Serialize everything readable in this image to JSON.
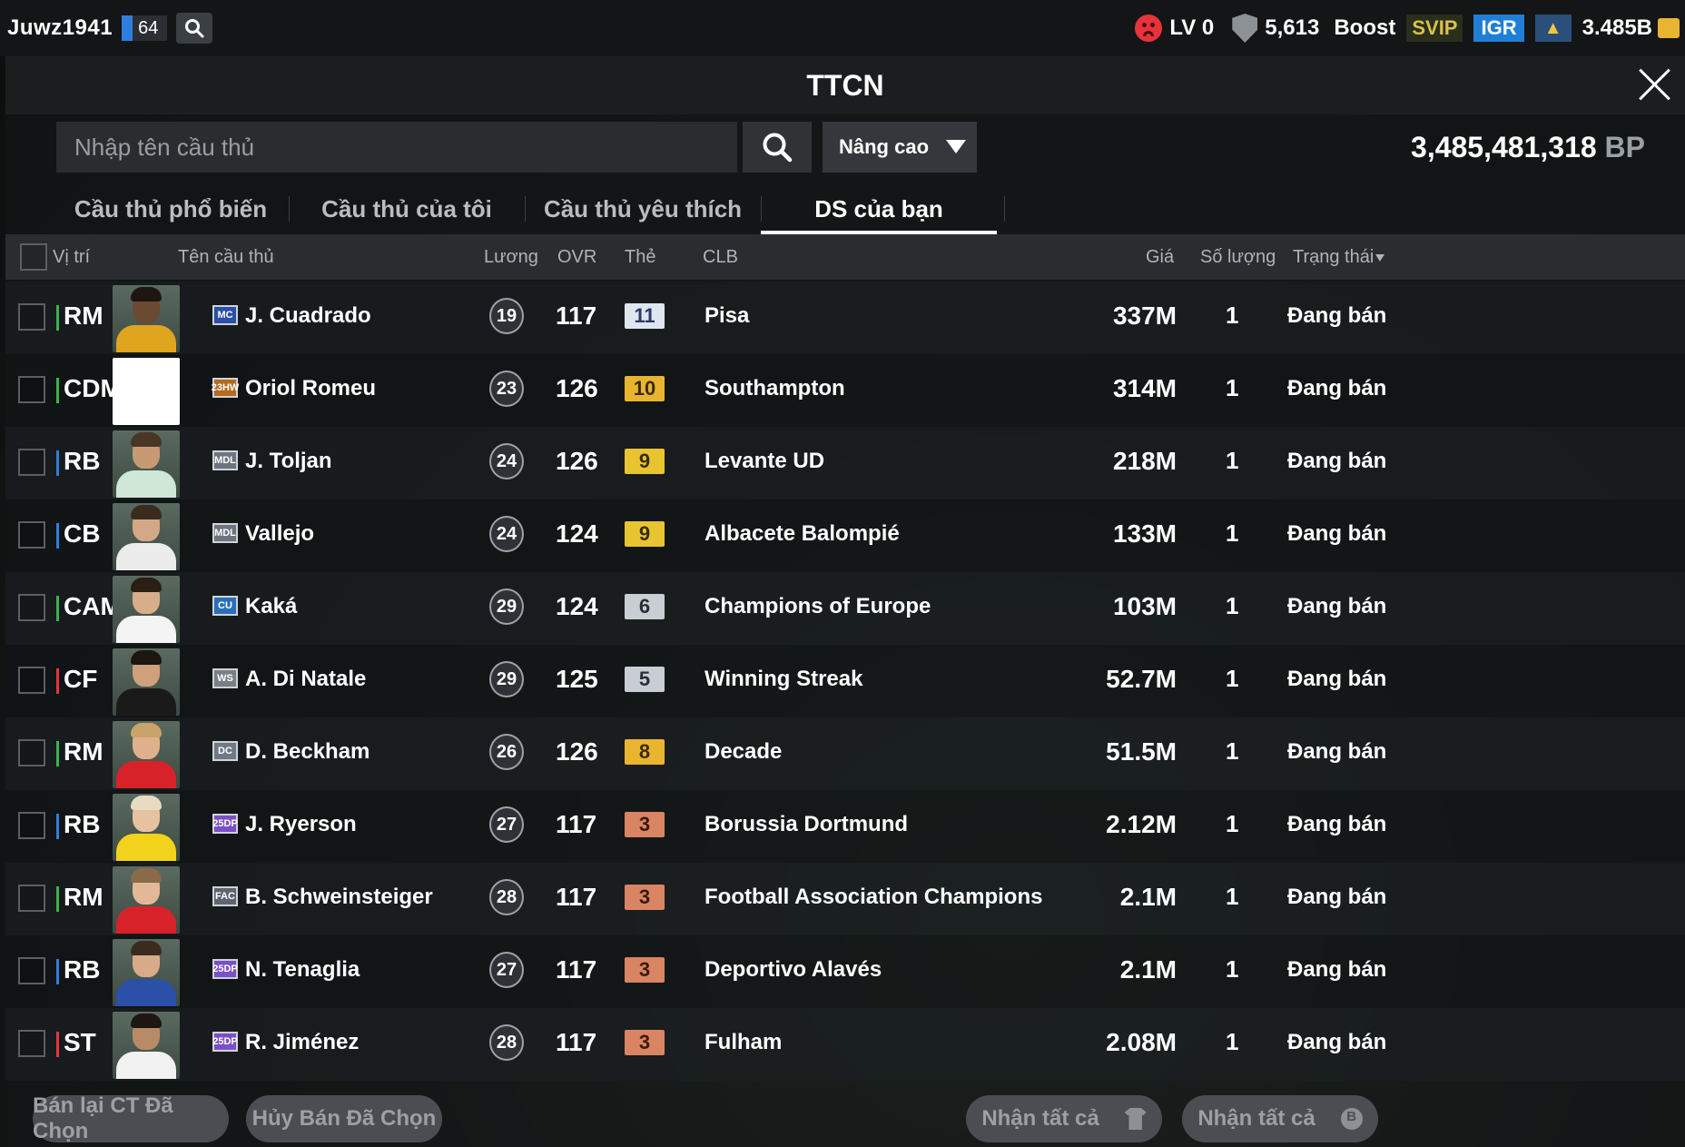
{
  "topbar": {
    "username": "Juwz1941",
    "level": "64",
    "lv": "LV 0",
    "shield_value": "5,613",
    "boost": "Boost",
    "svip": "SVIP",
    "igr": "IGR",
    "coins": "3.485B",
    "icons": [
      "search-icon",
      "sad-face-icon",
      "shield-icon",
      "arrow-up-icon",
      "coin-icon"
    ]
  },
  "panel": {
    "title": "TTCN",
    "search_placeholder": "Nhập tên cầu thủ",
    "advanced_label": "Nâng cao",
    "bp_value": "3,485,481,318",
    "bp_unit": "BP"
  },
  "tabs": [
    {
      "label": "Cầu thủ phổ biến",
      "active": false
    },
    {
      "label": "Cầu thủ của tôi",
      "active": false
    },
    {
      "label": "Cầu thủ yêu thích",
      "active": false
    },
    {
      "label": "DS của bạn",
      "active": true
    }
  ],
  "table": {
    "headers": {
      "position": "Vị trí",
      "name": "Tên cầu thủ",
      "wage": "Lương",
      "ovr": "OVR",
      "grade": "Thẻ",
      "club": "CLB",
      "price": "Giá",
      "qty": "Số lượng",
      "status": "Trạng thái"
    },
    "rows": [
      {
        "pos": "RM",
        "pos_color": "#39b54a",
        "season": "MC",
        "season_color": "#2a4fa8",
        "name": "J. Cuadrado",
        "wage": "19",
        "ovr": "117",
        "grade": "11",
        "grade_bg": "#dfe6f0",
        "grade_fg": "#2a3a6a",
        "club": "Pisa",
        "price": "337M",
        "qty": "1",
        "status": "Đang bán",
        "face": {
          "skin": "#6b4a33",
          "hair": "#1e1612",
          "shirt": "#e0a51f"
        }
      },
      {
        "pos": "CDM",
        "pos_color": "#39b54a",
        "season": "23HW",
        "season_color": "#b46a1e",
        "name": "Oriol Romeu",
        "wage": "23",
        "ovr": "126",
        "grade": "10",
        "grade_bg": "#e9b530",
        "grade_fg": "#3a2a05",
        "club": "Southampton",
        "price": "314M",
        "qty": "1",
        "status": "Đang bán",
        "face": {
          "skin": "#ffffff",
          "hair": "#ffffff",
          "shirt": "#ffffff"
        }
      },
      {
        "pos": "RB",
        "pos_color": "#2f7de1",
        "season": "MDL",
        "season_color": "#6b7480",
        "name": "J. Toljan",
        "wage": "24",
        "ovr": "126",
        "grade": "9",
        "grade_bg": "#e9c431",
        "grade_fg": "#3a2a05",
        "club": "Levante UD",
        "price": "218M",
        "qty": "1",
        "status": "Đang bán",
        "face": {
          "skin": "#c89a74",
          "hair": "#4a3626",
          "shirt": "#cfe7d6"
        }
      },
      {
        "pos": "CB",
        "pos_color": "#2f7de1",
        "season": "MDL",
        "season_color": "#6b7480",
        "name": "Vallejo",
        "wage": "24",
        "ovr": "124",
        "grade": "9",
        "grade_bg": "#e9c431",
        "grade_fg": "#3a2a05",
        "club": "Albacete Balompié",
        "price": "133M",
        "qty": "1",
        "status": "Đang bán",
        "face": {
          "skin": "#d4a886",
          "hair": "#3b2a1e",
          "shirt": "#ececec"
        }
      },
      {
        "pos": "CAM",
        "pos_color": "#39b54a",
        "season": "CU",
        "season_color": "#2a6fb8",
        "name": "Kaká",
        "wage": "29",
        "ovr": "124",
        "grade": "6",
        "grade_bg": "#c9ced4",
        "grade_fg": "#2a2e33",
        "club": "Champions of Europe",
        "price": "103M",
        "qty": "1",
        "status": "Đang bán",
        "face": {
          "skin": "#d8ad8a",
          "hair": "#2b1e14",
          "shirt": "#f4f4f4"
        }
      },
      {
        "pos": "CF",
        "pos_color": "#e8333a",
        "season": "WS",
        "season_color": "#7a7f86",
        "name": "A. Di Natale",
        "wage": "29",
        "ovr": "125",
        "grade": "5",
        "grade_bg": "#c9ced4",
        "grade_fg": "#2a2e33",
        "club": "Winning Streak",
        "price": "52.7M",
        "qty": "1",
        "status": "Đang bán",
        "face": {
          "skin": "#cfa07c",
          "hair": "#1c1612",
          "shirt": "#1a1a1a"
        }
      },
      {
        "pos": "RM",
        "pos_color": "#39b54a",
        "season": "DC",
        "season_color": "#6f7a86",
        "name": "D. Beckham",
        "wage": "26",
        "ovr": "126",
        "grade": "8",
        "grade_bg": "#e9b530",
        "grade_fg": "#3a2a05",
        "club": "Decade",
        "price": "51.5M",
        "qty": "1",
        "status": "Đang bán",
        "face": {
          "skin": "#e0b08c",
          "hair": "#c9a36a",
          "shirt": "#d8222a"
        }
      },
      {
        "pos": "RB",
        "pos_color": "#2f7de1",
        "season": "25DP",
        "season_color": "#7b4fc6",
        "name": "J. Ryerson",
        "wage": "27",
        "ovr": "117",
        "grade": "3",
        "grade_bg": "#d98463",
        "grade_fg": "#3a1a0e",
        "club": "Borussia Dortmund",
        "price": "2.12M",
        "qty": "1",
        "status": "Đang bán",
        "face": {
          "skin": "#e6c2a0",
          "hair": "#e8dcc0",
          "shirt": "#f2d21a"
        }
      },
      {
        "pos": "RM",
        "pos_color": "#39b54a",
        "season": "FAC",
        "season_color": "#5d6670",
        "name": "B. Schweinsteiger",
        "wage": "28",
        "ovr": "117",
        "grade": "3",
        "grade_bg": "#d98463",
        "grade_fg": "#3a1a0e",
        "club": "Football Association Champions",
        "price": "2.1M",
        "qty": "1",
        "status": "Đang bán",
        "face": {
          "skin": "#e3b896",
          "hair": "#8a6a48",
          "shirt": "#d8222a"
        }
      },
      {
        "pos": "RB",
        "pos_color": "#2f7de1",
        "season": "25DP",
        "season_color": "#7b4fc6",
        "name": "N. Tenaglia",
        "wage": "27",
        "ovr": "117",
        "grade": "3",
        "grade_bg": "#d98463",
        "grade_fg": "#3a1a0e",
        "club": "Deportivo Alavés",
        "price": "2.1M",
        "qty": "1",
        "status": "Đang bán",
        "face": {
          "skin": "#d8ab88",
          "hair": "#3b2a1e",
          "shirt": "#2c4fa8"
        }
      },
      {
        "pos": "ST",
        "pos_color": "#e8333a",
        "season": "25DP",
        "season_color": "#7b4fc6",
        "name": "R. Jiménez",
        "wage": "28",
        "ovr": "117",
        "grade": "3",
        "grade_bg": "#d98463",
        "grade_fg": "#3a1a0e",
        "club": "Fulham",
        "price": "2.08M",
        "qty": "1",
        "status": "Đang bán",
        "face": {
          "skin": "#b88a66",
          "hair": "#1e1612",
          "shirt": "#f2f2f2"
        }
      }
    ]
  },
  "buttons": {
    "resell_selected": "Bán lại CT Đã Chọn",
    "cancel_selected": "Hủy Bán Đã Chọn",
    "receive_all_players": "Nhận tất cả",
    "receive_all_bp": "Nhận tất cả"
  }
}
